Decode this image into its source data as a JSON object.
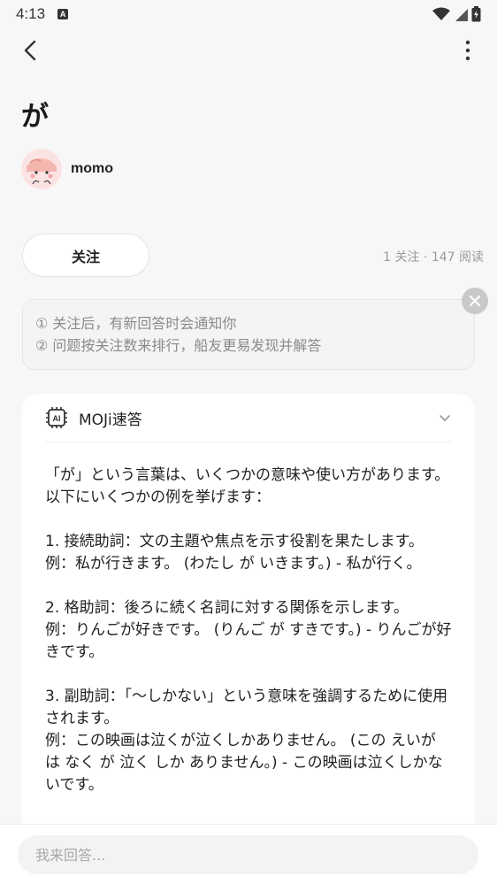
{
  "status_bar": {
    "time": "4:13",
    "notification_icon": "a-notification-icon",
    "icons": [
      "wifi-icon",
      "signal-icon",
      "battery-icon"
    ]
  },
  "top_bar": {
    "back_icon": "back-arrow-icon",
    "more_icon": "more-vert-icon"
  },
  "question": {
    "title": "が",
    "author_name": "momo"
  },
  "follow": {
    "button_label": "关注",
    "stats": "1 关注 · 147 阅读"
  },
  "notice": {
    "line1": "① 关注后，有新回答时会通知你",
    "line2": "② 问题按关注数来排行，船友更易发现并解答"
  },
  "answer_card": {
    "title": "MOJi速答",
    "icon": "ai-chip-icon",
    "body": "「が」という言葉は、いくつかの意味や使い方があります。以下にいくつかの例を挙げます：\n\n1. 接続助詞：文の主題や焦点を示す役割を果たします。\n例：私が行きます。 (わたし が いきます。) - 私が行く。\n\n2. 格助詞：後ろに続く名詞に対する関係を示します。\n例：りんごが好きです。 (りんご が すきです。) - りんごが好きです。\n\n3. 副助詞：「〜しかない」という意味を強調するために使用されます。\n例：この映画は泣くが泣くしかありません。 (この えいが は なく が 泣く しか ありません。) - この映画は泣くしかないです。"
  },
  "reply": {
    "placeholder": "我来回答..."
  },
  "colors": {
    "page_bg": "#f7f7f7",
    "card_bg": "#ffffff",
    "muted_text": "#9a9a9a"
  }
}
